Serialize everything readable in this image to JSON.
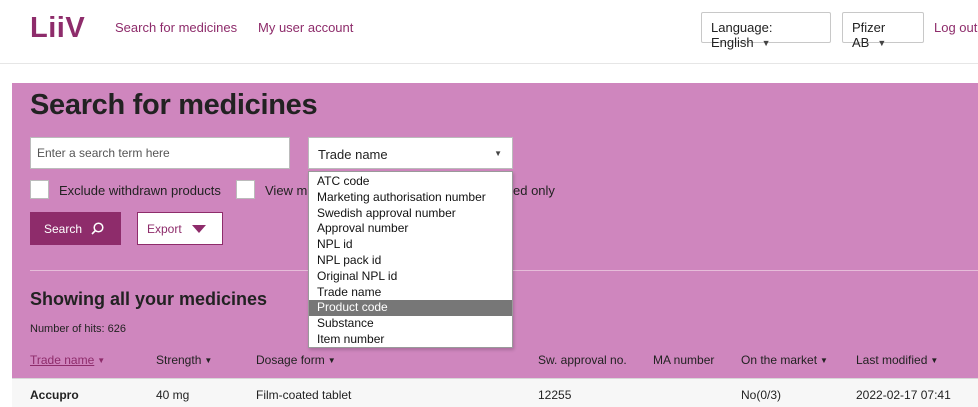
{
  "header": {
    "logo": "LiiV",
    "nav": {
      "search": "Search for medicines",
      "account": "My user account"
    },
    "language": "Language: English",
    "company": "Pfizer AB",
    "logout": "Log out"
  },
  "search": {
    "title": "Search for medicines",
    "placeholder": "Enter a search term here",
    "field_selected": "Trade name",
    "checkboxes": {
      "withdrawn": "Exclude withdrawn products",
      "view": "View ma",
      "third": "ed only"
    },
    "search_button": "Search",
    "export_button": "Export"
  },
  "dropdown": {
    "options": [
      "ATC code",
      "Marketing authorisation number",
      "Swedish approval number",
      "Approval number",
      "NPL id",
      "NPL pack id",
      "Original NPL id",
      "Trade name",
      "Product code",
      "Substance",
      "Item number"
    ],
    "highlighted": "Product code"
  },
  "results": {
    "title": "Showing all your medicines",
    "hits": "Number of hits: 626",
    "columns": {
      "trade": "Trade name",
      "strength": "Strength",
      "dosage": "Dosage form",
      "swapproval": "Sw. approval no.",
      "ma": "MA number",
      "market": "On the market",
      "modified": "Last modified"
    },
    "rows": [
      {
        "trade": "Accupro",
        "strength": "40 mg",
        "dosage": "Film-coated tablet",
        "swapproval": "12255",
        "ma": "",
        "market": "No(0/3)",
        "modified": "2022-02-17 07:41"
      }
    ]
  },
  "colors": {
    "brand": "#8e2c6b",
    "panel": "#cf86be",
    "highlight": "#777777"
  }
}
